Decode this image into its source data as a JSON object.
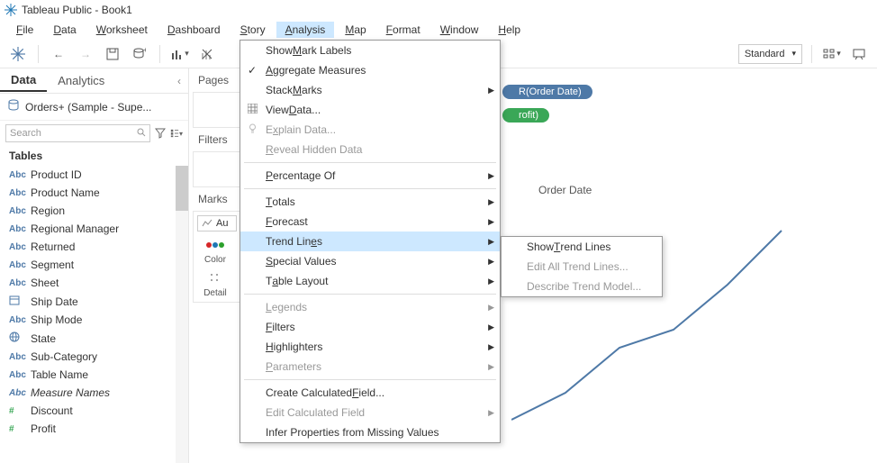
{
  "title": "Tableau Public - Book1",
  "menus": [
    "File",
    "Data",
    "Worksheet",
    "Dashboard",
    "Story",
    "Analysis",
    "Map",
    "Format",
    "Window",
    "Help"
  ],
  "active_menu": "Analysis",
  "toolbar": {
    "standard_label": "Standard"
  },
  "left": {
    "tabs": {
      "data": "Data",
      "analytics": "Analytics"
    },
    "datasource": "Orders+ (Sample - Supe...",
    "search_placeholder": "Search",
    "tables_header": "Tables",
    "fields": [
      {
        "type": "Abc",
        "name": "Product ID"
      },
      {
        "type": "Abc",
        "name": "Product Name"
      },
      {
        "type": "Abc",
        "name": "Region"
      },
      {
        "type": "Abc",
        "name": "Regional Manager"
      },
      {
        "type": "Abc",
        "name": "Returned"
      },
      {
        "type": "Abc",
        "name": "Segment"
      },
      {
        "type": "Abc",
        "name": "Sheet"
      },
      {
        "type": "date",
        "name": "Ship Date"
      },
      {
        "type": "Abc",
        "name": "Ship Mode"
      },
      {
        "type": "globe",
        "name": "State"
      },
      {
        "type": "Abc",
        "name": "Sub-Category"
      },
      {
        "type": "Abc",
        "name": "Table Name"
      },
      {
        "type": "Abc",
        "name": "Measure Names",
        "italic": true
      },
      {
        "type": "#",
        "name": "Discount",
        "green": true
      },
      {
        "type": "#",
        "name": "Profit",
        "green": true
      }
    ]
  },
  "shelves": {
    "pages": "Pages",
    "filters": "Filters",
    "marks": "Marks",
    "marks_type_short": "Au",
    "color": "Color",
    "detail": "Detail"
  },
  "canvas": {
    "columns_pill": "R(Order Date)",
    "rows_pill": "rofit)",
    "x_label": "Order Date"
  },
  "analysis_menu": [
    {
      "label": "Show Mark Labels",
      "u": 5
    },
    {
      "label": "Aggregate Measures",
      "u": 0,
      "checked": true
    },
    {
      "label": "Stack Marks",
      "u": 6,
      "sub": true
    },
    {
      "label": "View Data...",
      "u": 5,
      "icon": "grid"
    },
    {
      "label": "Explain Data...",
      "u": 1,
      "disabled": true,
      "icon": "bulb"
    },
    {
      "label": "Reveal Hidden Data",
      "u": 0,
      "disabled": true
    },
    {
      "sep": true
    },
    {
      "label": "Percentage Of",
      "u": 0,
      "sub": true
    },
    {
      "sep": true
    },
    {
      "label": "Totals",
      "u": 0,
      "sub": true
    },
    {
      "label": "Forecast",
      "u": 0,
      "sub": true
    },
    {
      "label": "Trend Lines",
      "u": 9,
      "sub": true,
      "hover": true
    },
    {
      "label": "Special Values",
      "u": 0,
      "sub": true
    },
    {
      "label": "Table Layout",
      "u": 1,
      "sub": true
    },
    {
      "sep": true
    },
    {
      "label": "Legends",
      "u": 0,
      "sub": true,
      "disabled": true
    },
    {
      "label": "Filters",
      "u": 0,
      "sub": true
    },
    {
      "label": "Highlighters",
      "u": 0,
      "sub": true
    },
    {
      "label": "Parameters",
      "u": 0,
      "sub": true,
      "disabled": true
    },
    {
      "sep": true
    },
    {
      "label": "Create Calculated Field...",
      "u": 18
    },
    {
      "label": "Edit Calculated Field",
      "u": -1,
      "sub": true,
      "disabled": true
    },
    {
      "label": "Infer Properties from Missing Values",
      "u": -1
    }
  ],
  "trend_submenu": [
    {
      "label": "Show Trend Lines",
      "u": 5
    },
    {
      "label": "Edit All Trend Lines...",
      "u": -1,
      "disabled": true
    },
    {
      "label": "Describe Trend Model...",
      "u": -1,
      "disabled": true
    }
  ]
}
